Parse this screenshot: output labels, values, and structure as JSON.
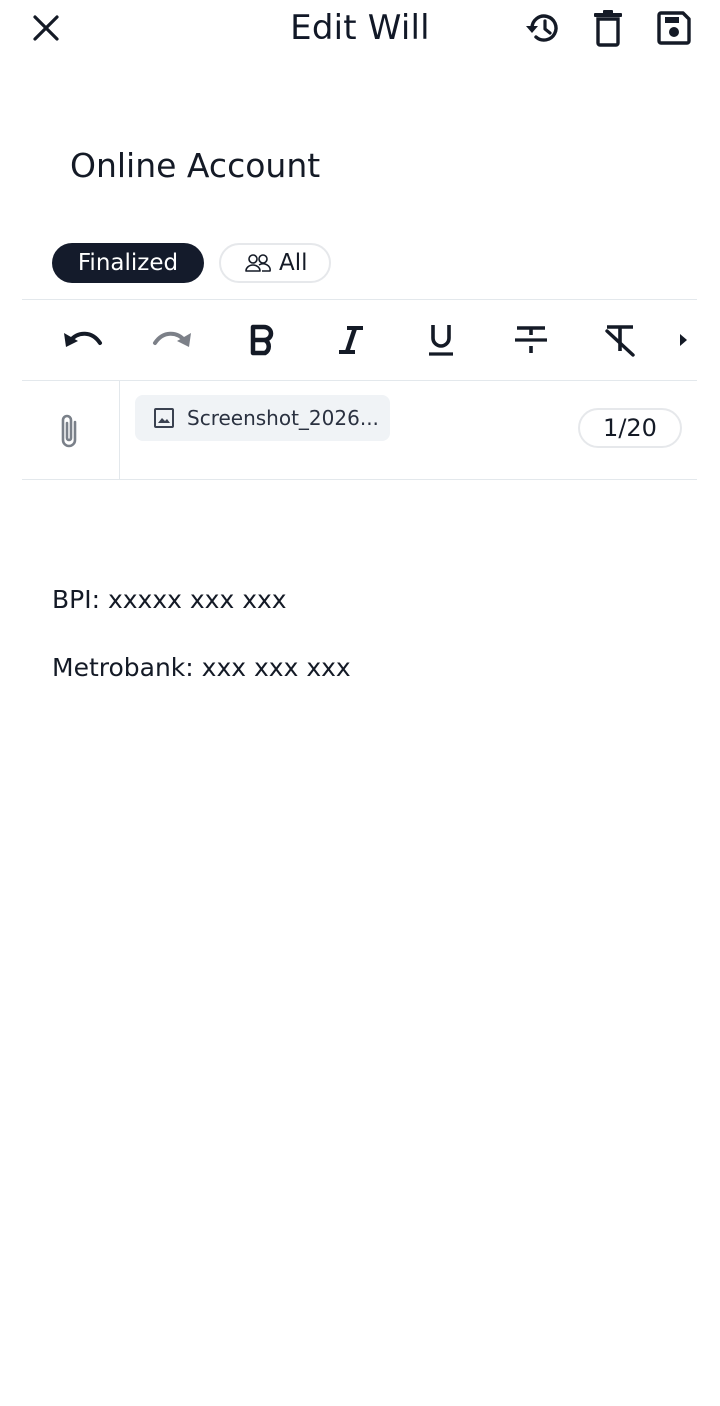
{
  "header": {
    "title": "Edit Will",
    "icons": {
      "close": "close-icon",
      "history": "history-icon",
      "delete": "trash-icon",
      "save": "save-icon"
    }
  },
  "note": {
    "title": "Online Account"
  },
  "chips": {
    "status_label": "Finalized",
    "visibility_label": "All",
    "visibility_icon": "people-icon",
    "status_bg": "#141b2b"
  },
  "toolbar": {
    "items": [
      "undo",
      "redo",
      "bold",
      "italic",
      "underline",
      "strikethrough",
      "clear-format",
      "more"
    ]
  },
  "attachments": {
    "file_name": "Screenshot_2026...",
    "counter": "1/20"
  },
  "body": {
    "lines": [
      "BPI: xxxxx xxx xxx",
      "Metrobank: xxx xxx xxx"
    ]
  }
}
